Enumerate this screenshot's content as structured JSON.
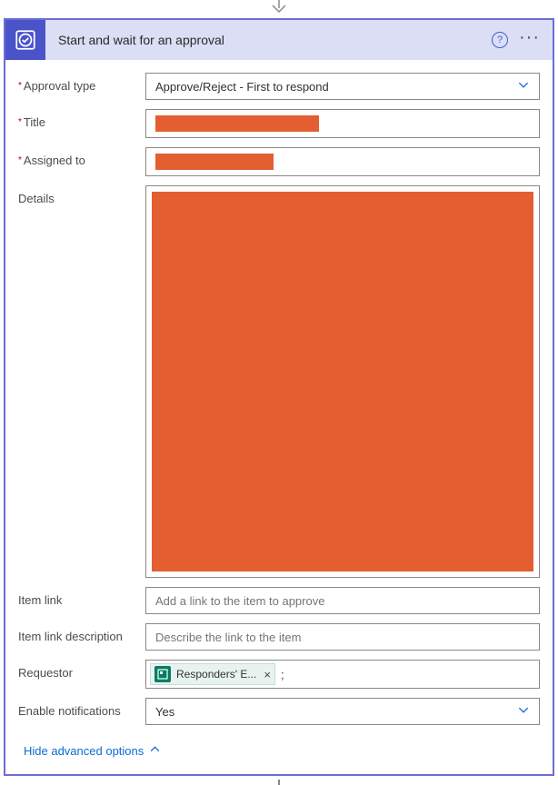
{
  "header": {
    "title": "Start and wait for an approval"
  },
  "fields": {
    "approval_type": {
      "label": "Approval type",
      "value": "Approve/Reject - First to respond"
    },
    "title": {
      "label": "Title"
    },
    "assigned_to": {
      "label": "Assigned to"
    },
    "details": {
      "label": "Details"
    },
    "item_link": {
      "label": "Item link",
      "placeholder": "Add a link to the item to approve"
    },
    "item_link_description": {
      "label": "Item link description",
      "placeholder": "Describe the link to the item"
    },
    "requestor": {
      "label": "Requestor",
      "token": "Responders' E...",
      "after_token": ";"
    },
    "enable_notifications": {
      "label": "Enable notifications",
      "value": "Yes"
    }
  },
  "footer": {
    "hide_advanced": "Hide advanced options"
  }
}
